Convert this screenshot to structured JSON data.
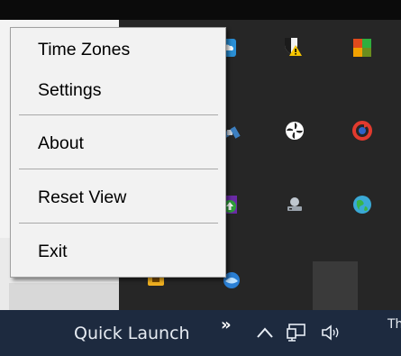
{
  "context_menu": {
    "items": [
      {
        "label": "Time Zones"
      },
      {
        "label": "Settings"
      },
      {
        "label": "About"
      },
      {
        "label": "Reset View"
      },
      {
        "label": "Exit"
      }
    ]
  },
  "taskbar": {
    "toolbar_label": "Quick Launch",
    "overflow_chevron": "»",
    "clock_partial": "Th",
    "icons": [
      "show-hidden-icons-chevron",
      "network-icon",
      "volume-icon"
    ]
  },
  "tray_overflow": {
    "icons": [
      "cloud-sync-icon",
      "security-shield-warning-icon",
      "colorful-app-icon",
      "satellite-icon",
      "fan-icon",
      "red-sync-icon",
      "update-icon",
      "drive-icon",
      "globe-icon",
      "yellow-app-icon",
      "blue-app-icon"
    ]
  },
  "colors": {
    "taskbar": "#1d2a3f",
    "tray_panel": "#262626",
    "menu_background": "#f2f2f2"
  }
}
